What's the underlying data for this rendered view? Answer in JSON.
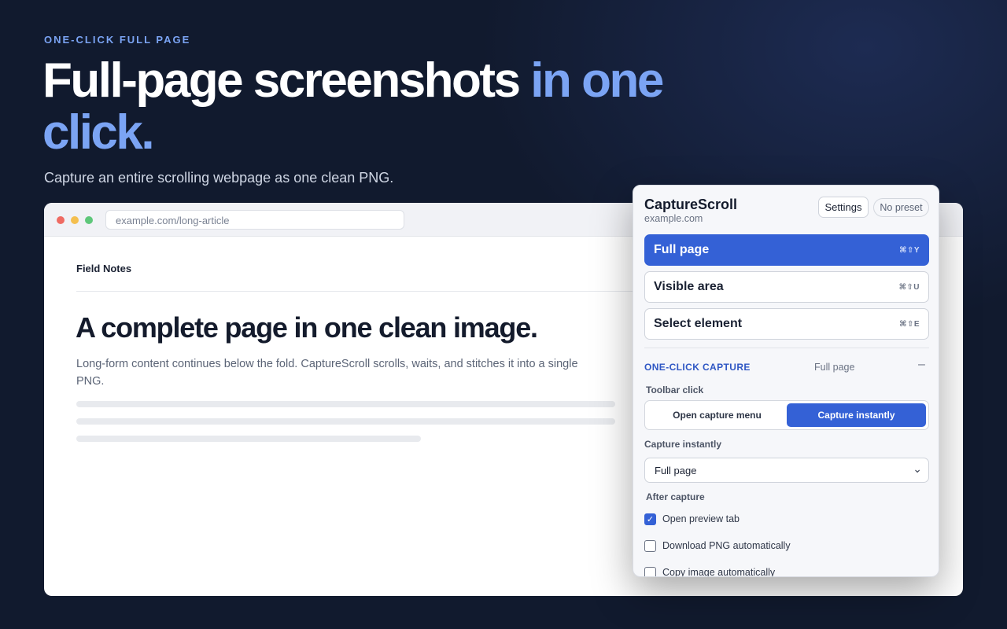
{
  "hero": {
    "eyebrow": "ONE-CLICK FULL PAGE",
    "headline_main": "Full-page screenshots ",
    "headline_accent": "in one click.",
    "subhead": "Capture an entire scrolling webpage as one clean PNG."
  },
  "browser": {
    "url": "example.com/long-article",
    "page": {
      "brand": "Field Notes",
      "heading": "A complete page in one clean image.",
      "body": "Long-form content continues below the fold. CaptureScroll scrolls, waits, and stitches it into a single PNG."
    }
  },
  "popup": {
    "title": "CaptureScroll",
    "domain": "example.com",
    "settings_label": "Settings",
    "preset_label": "No preset",
    "modes": [
      {
        "label": "Full page",
        "shortcut": "⌘⇧Y",
        "active": true
      },
      {
        "label": "Visible area",
        "shortcut": "⌘⇧U",
        "active": false
      },
      {
        "label": "Select element",
        "shortcut": "⌘⇧E",
        "active": false
      }
    ],
    "section": {
      "title": "ONE-CLICK CAPTURE",
      "value": "Full page",
      "collapse": "–"
    },
    "toolbar_click": {
      "label": "Toolbar click",
      "options": [
        "Open capture menu",
        "Capture instantly"
      ],
      "selected": "Capture instantly"
    },
    "capture_instantly": {
      "label": "Capture instantly",
      "value": "Full page"
    },
    "after_capture": {
      "label": "After capture",
      "options": [
        {
          "label": "Open preview tab",
          "checked": true
        },
        {
          "label": "Download PNG automatically",
          "checked": false
        },
        {
          "label": "Copy image automatically",
          "checked": false
        }
      ]
    }
  },
  "colors": {
    "background": "#111a2e",
    "accent": "#7ba4f4",
    "primary": "#3461d6"
  }
}
